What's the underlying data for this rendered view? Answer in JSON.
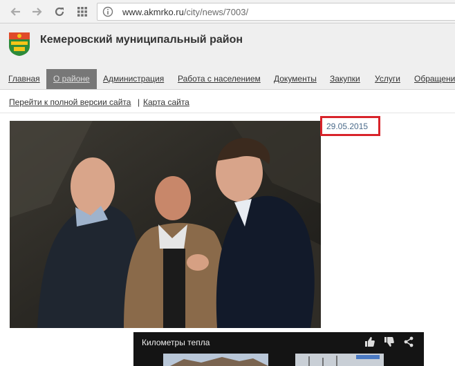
{
  "browser": {
    "url_host": "www.akmrko.ru",
    "url_path": "/city/news/7003/"
  },
  "site": {
    "title": "Кемеровский муниципальный район"
  },
  "menu": {
    "items": [
      {
        "label": "Главная"
      },
      {
        "label": "О районе"
      },
      {
        "label": "Администрация"
      },
      {
        "label": "Работа с населением"
      },
      {
        "label": "Документы"
      },
      {
        "label": "Закупки"
      },
      {
        "label": "Услуги"
      },
      {
        "label": "Обращени"
      }
    ]
  },
  "subbar": {
    "full_version": "Перейти к полной версии сайта",
    "separator": "|",
    "sitemap": "Карта сайта"
  },
  "article": {
    "date": "29.05.2015"
  },
  "video": {
    "title": "Километры тепла"
  },
  "colors": {
    "highlight": "#d8232a",
    "menu_active": "#777777"
  }
}
